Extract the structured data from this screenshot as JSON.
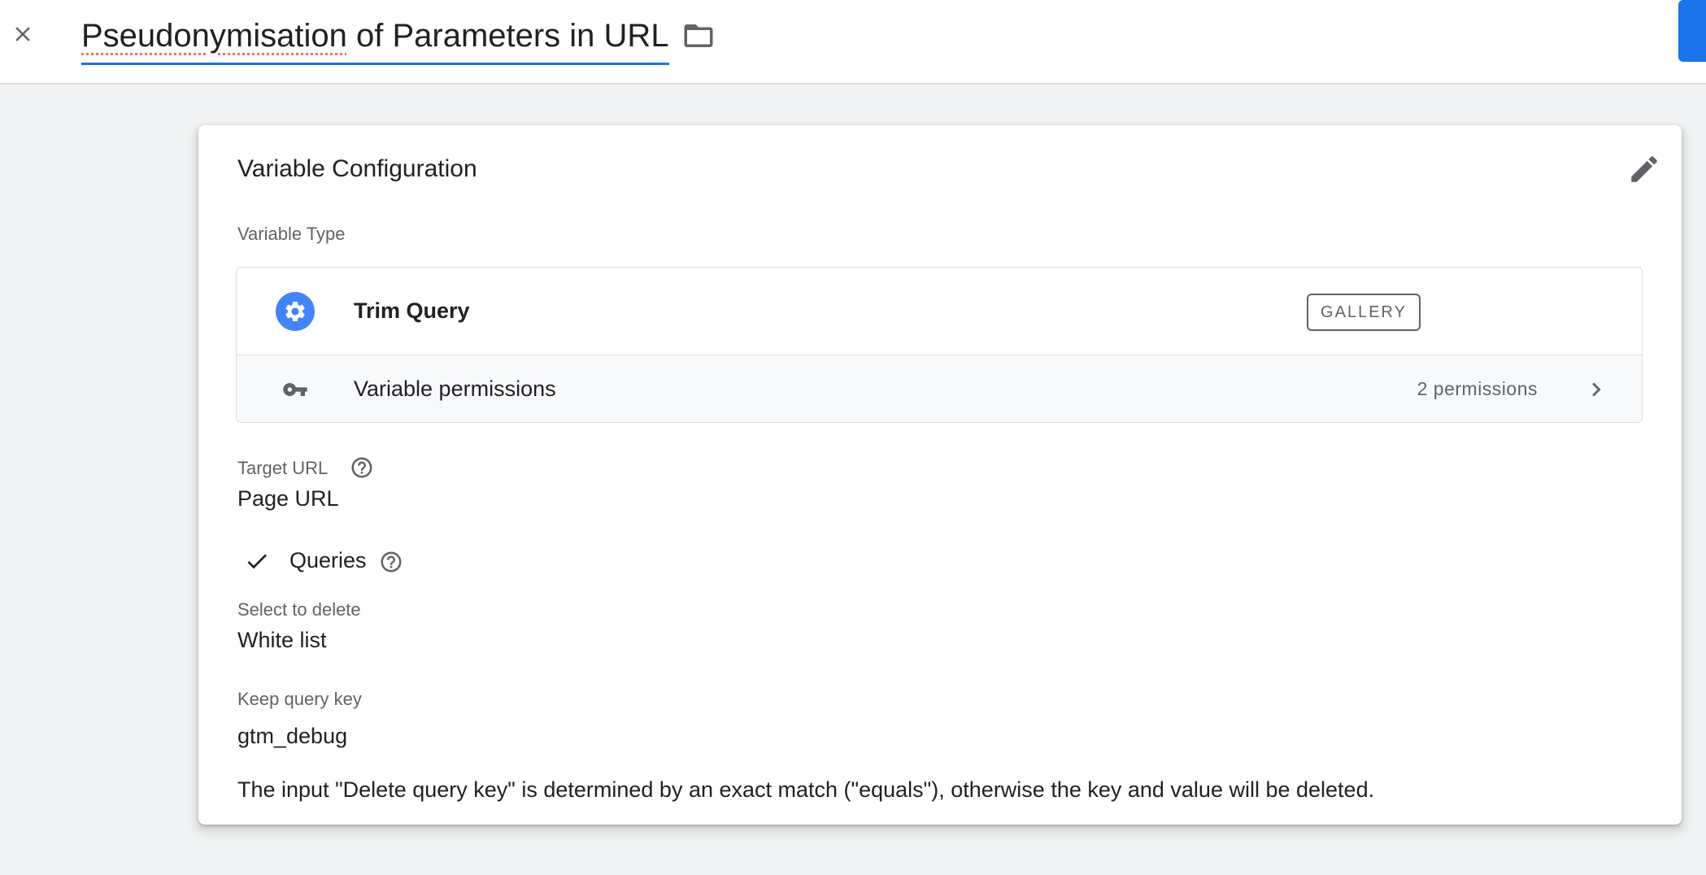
{
  "header": {
    "title_part1": "Pseudonymisation",
    "title_part2": " of Parameters in URL",
    "close_icon": "close-icon",
    "folder_icon": "folder-icon"
  },
  "card": {
    "title": "Variable Configuration",
    "variable_type_label": "Variable Type",
    "type": {
      "name": "Trim Query",
      "badge": "GALLERY",
      "icon": "gear-icon"
    },
    "permissions": {
      "label": "Variable permissions",
      "count": "2 permissions",
      "icon": "key-icon"
    },
    "target_url": {
      "label": "Target URL",
      "value": "Page URL"
    },
    "queries": {
      "label": "Queries",
      "checked": true
    },
    "select_to_delete": {
      "label": "Select to delete",
      "value": "White list"
    },
    "keep_query_key": {
      "label": "Keep query key",
      "value": "gtm_debug"
    },
    "note": "The input \"Delete query key\" is determined by an exact match (\"equals\"), otherwise the key and value will be deleted."
  },
  "colors": {
    "accent": "#1a73e8",
    "gear_bg": "#4285f4",
    "text_primary": "#202124",
    "text_secondary": "#5f6368"
  }
}
